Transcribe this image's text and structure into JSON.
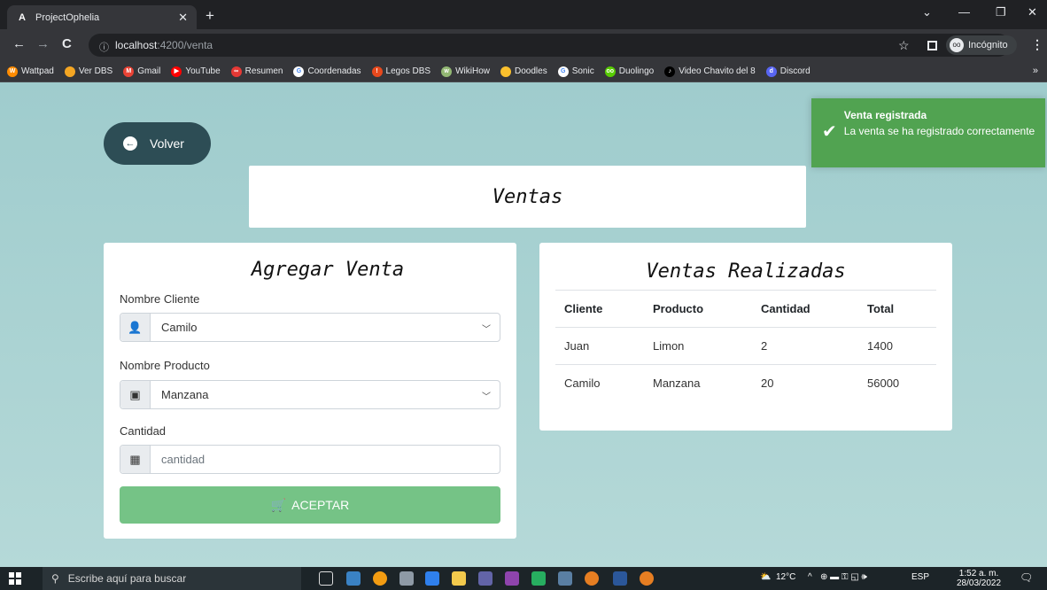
{
  "browser": {
    "tab_title": "ProjectOphelia",
    "tab_favicon": "A",
    "url_host": "localhost",
    "url_rest": ":4200/venta",
    "incognito_label": "Incógnito",
    "bookmarks": [
      {
        "label": "Wattpad",
        "color": "#ff8c00",
        "icon": "W"
      },
      {
        "label": "Ver DBS",
        "color": "#f4a623",
        "icon": ""
      },
      {
        "label": "Gmail",
        "color": "#ea4335",
        "icon": "M"
      },
      {
        "label": "YouTube",
        "color": "#ff0000",
        "icon": "▶"
      },
      {
        "label": "Resumen",
        "color": "#e53935",
        "icon": "∞"
      },
      {
        "label": "Coordenadas",
        "color": "#ffffff",
        "icon": "G"
      },
      {
        "label": "Legos DBS",
        "color": "#e8491d",
        "icon": "!"
      },
      {
        "label": "WikiHow",
        "color": "#93b874",
        "icon": "w"
      },
      {
        "label": "Doodles",
        "color": "#fbc02d",
        "icon": ""
      },
      {
        "label": "Sonic",
        "color": "#ffffff",
        "icon": "G"
      },
      {
        "label": "Duolingo",
        "color": "#58cc02",
        "icon": "oo"
      },
      {
        "label": "Video Chavito del 8",
        "color": "#000000",
        "icon": "♪"
      },
      {
        "label": "Discord",
        "color": "#5865f2",
        "icon": "d"
      }
    ]
  },
  "page": {
    "back_label": "Volver",
    "title": "Ventas",
    "form": {
      "title": "Agregar Venta",
      "cliente_label": "Nombre Cliente",
      "cliente_value": "Camilo",
      "producto_label": "Nombre Producto",
      "producto_value": "Manzana",
      "cantidad_label": "Cantidad",
      "cantidad_placeholder": "cantidad",
      "submit_label": "ACEPTAR"
    },
    "table": {
      "title": "Ventas Realizadas",
      "headers": [
        "Cliente",
        "Producto",
        "Cantidad",
        "Total"
      ],
      "rows": [
        [
          "Juan",
          "Limon",
          "2",
          "1400"
        ],
        [
          "Camilo",
          "Manzana",
          "20",
          "56000"
        ]
      ]
    },
    "toast": {
      "title": "Venta registrada",
      "message": "La venta se ha registrado correctamente"
    }
  },
  "taskbar": {
    "search_placeholder": "Escribe aquí para buscar",
    "weather": "12°C",
    "language": "ESP",
    "time": "1:52 a. m.",
    "date": "28/03/2022",
    "notifications": "3"
  }
}
